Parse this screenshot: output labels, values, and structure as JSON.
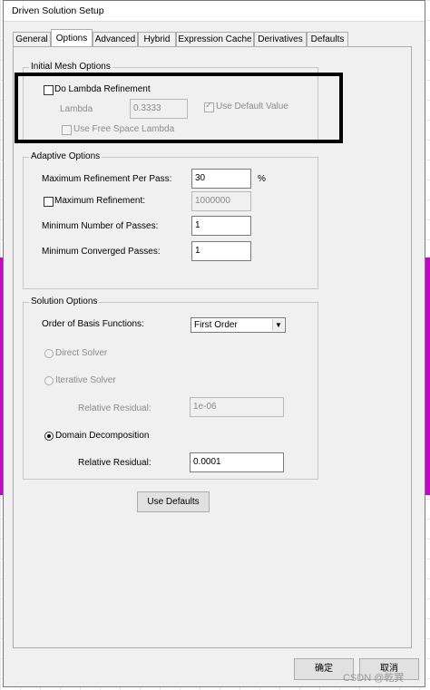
{
  "window": {
    "title": "Driven Solution Setup"
  },
  "tabs": [
    "General",
    "Options",
    "Advanced",
    "Hybrid",
    "Expression Cache",
    "Derivatives",
    "Defaults"
  ],
  "initial_mesh": {
    "title": "Initial Mesh Options",
    "do_lambda_label": "Do Lambda Refinement",
    "lambda_label": "Lambda",
    "lambda_value": "0.3333",
    "use_default_label": "Use Default Value",
    "use_free_space_label": "Use Free Space Lambda"
  },
  "adaptive": {
    "title": "Adaptive Options",
    "max_ref_per_pass_label": "Maximum Refinement Per Pass:",
    "max_ref_per_pass_value": "30",
    "percent": "%",
    "max_ref_label": "Maximum Refinement:",
    "max_ref_value": "1000000",
    "min_passes_label": "Minimum Number of Passes:",
    "min_passes_value": "1",
    "min_converged_label": "Minimum Converged Passes:",
    "min_converged_value": "1"
  },
  "solution": {
    "title": "Solution Options",
    "order_label": "Order of Basis Functions:",
    "order_value": "First Order",
    "direct_label": "Direct Solver",
    "iterative_label": "Iterative Solver",
    "rel_residual_label": "Relative Residual:",
    "rel_residual_iter_value": "1e-06",
    "domain_label": "Domain Decomposition",
    "rel_residual_dd_label": "Relative Residual:",
    "rel_residual_dd_value": "0.0001"
  },
  "buttons": {
    "use_defaults": "Use Defaults",
    "ok": "确定",
    "cancel": "取消"
  },
  "watermark": "CSDN @乾巽"
}
